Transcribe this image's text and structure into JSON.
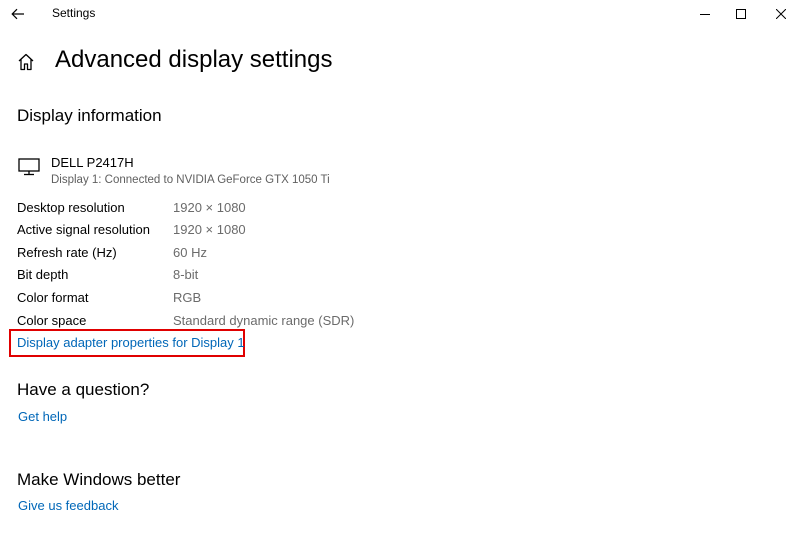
{
  "window": {
    "title": "Settings"
  },
  "page": {
    "title": "Advanced display settings"
  },
  "display_info": {
    "heading": "Display information",
    "monitor_name": "DELL P2417H",
    "monitor_subtitle": "Display 1: Connected to NVIDIA GeForce GTX 1050 Ti",
    "rows": [
      {
        "label": "Desktop resolution",
        "value": "1920 × 1080"
      },
      {
        "label": "Active signal resolution",
        "value": "1920 × 1080"
      },
      {
        "label": "Refresh rate (Hz)",
        "value": "60 Hz"
      },
      {
        "label": "Bit depth",
        "value": "8-bit"
      },
      {
        "label": "Color format",
        "value": "RGB"
      },
      {
        "label": "Color space",
        "value": "Standard dynamic range (SDR)"
      }
    ],
    "adapter_link": "Display adapter properties for Display 1"
  },
  "question": {
    "heading": "Have a question?",
    "link": "Get help"
  },
  "feedback": {
    "heading": "Make Windows better",
    "link": "Give us feedback"
  },
  "colors": {
    "link": "#0067b8",
    "highlight": "#e00000"
  },
  "icons": {
    "back": "back-arrow-icon",
    "home": "home-icon",
    "monitor": "monitor-icon",
    "minimize": "minimize-icon",
    "maximize": "maximize-icon",
    "close": "close-icon"
  }
}
